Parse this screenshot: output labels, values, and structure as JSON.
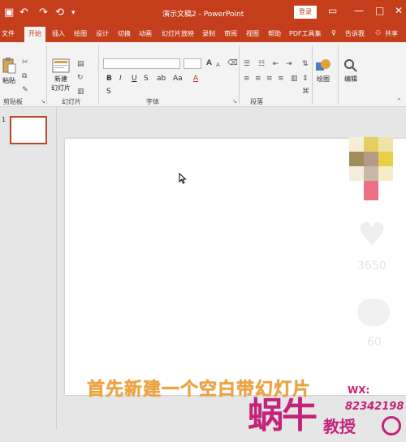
{
  "titlebar": {
    "title": "演示文稿2  -  PowerPoint",
    "signin": "登录",
    "save_icon": "save-icon",
    "undo_icon": "undo-icon",
    "redo_icon": "redo-icon"
  },
  "tabs": {
    "file": "文件",
    "home": "开始",
    "insert": "插入",
    "draw": "绘图",
    "design": "设计",
    "transitions": "切换",
    "animations": "动画",
    "slideshow": "幻灯片放映",
    "record": "录制",
    "review": "审阅",
    "view": "视图",
    "help": "帮助",
    "pdf": "PDF工具集",
    "tellme": "告诉我",
    "share": "共享"
  },
  "ribbon": {
    "paste": "粘贴",
    "clipboard": "剪贴板",
    "new_slide_line1": "新建",
    "new_slide_line2": "幻灯片",
    "slides_group": "幻灯片",
    "font_group": "字体",
    "paragraph_group": "段落",
    "drawing": "绘图",
    "editing": "编辑",
    "bold": "B",
    "italic": "I",
    "underline": "U",
    "strike": "S",
    "font_color": "A",
    "font_size_up": "A"
  },
  "thumbnails": {
    "slide_number": "1"
  },
  "overlay": {
    "like_count": "3650",
    "comment_count": "60",
    "caption": "首先新建一个空白带幻灯片",
    "watermark_brand": "蜗牛",
    "watermark_sub": "教授",
    "watermark_wx": "WX:",
    "watermark_id": "82342198"
  },
  "colors": {
    "accent": "#c43e1c",
    "watermark": "#c3247a",
    "caption": "#f0a23c"
  }
}
